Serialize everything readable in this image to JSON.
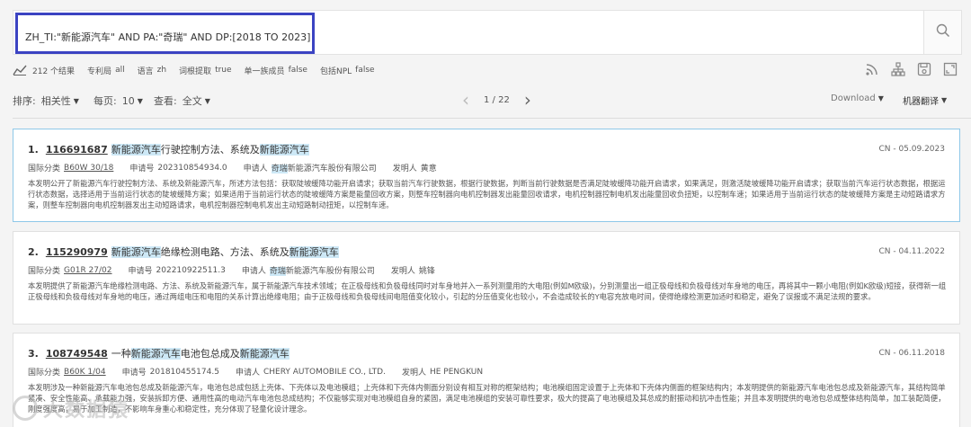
{
  "search": {
    "query": "ZH_TI:\"新能源汽车\" AND PA:\"奇瑞\" AND DP:[2018 TO 2023]"
  },
  "stats": {
    "results": "212 个结果",
    "patent_office_label": "专利局",
    "patent_office_value": "all",
    "language_label": "语言",
    "language_value": "zh",
    "stemming_label": "词根提取",
    "stemming_value": "true",
    "single_family_label": "单一族成员",
    "single_family_value": "false",
    "npl_label": "包括NPL",
    "npl_value": "false"
  },
  "toolbar": {
    "sort_label": "排序:",
    "sort_value": "相关性",
    "per_page_label": "每页:",
    "per_page_value": "10",
    "view_label": "查看:",
    "view_value": "全文",
    "page_indicator": "1 / 22",
    "download_label": "Download",
    "translate_label": "机器翻译"
  },
  "results": [
    {
      "index": "1.",
      "pub_no": "116691687",
      "title_hl1": "新能源汽车",
      "title_mid": "行驶控制方法、系统及",
      "title_hl2": "新能源汽车",
      "date": "CN - 05.09.2023",
      "ipc_label": "国际分类",
      "ipc": "B60W 30/18",
      "app_label": "申请号",
      "app_no": "202310854934.0",
      "applicant_label": "申请人",
      "applicant_hl": "奇瑞",
      "applicant_rest": "新能源汽车股份有限公司",
      "inventor_label": "发明人",
      "inventor": "黄意",
      "abstract": "本发明公开了新能源汽车行驶控制方法、系统及新能源汽车，所述方法包括：获取陡坡缓降功能开启请求；获取当前汽车行驶数据，根据行驶数据，判断当前行驶数据是否满足陡坡缓降功能开启请求，如果满足，则激活陡坡缓降功能开启请求；获取当前汽车运行状态数据，根据运行状态数据，选择适用于当前运行状态的陡坡缓降方案；如果适用于当前运行状态的陡坡缓降方案是能量回收方案，则整车控制器向电机控制器发出能量回收请求，电机控制器控制电机发出能量回收负扭矩，以控制车速；如果适用于当前运行状态的陡坡缓降方案是主动短路请求方案，则整车控制器向电机控制器发出主动短路请求，电机控制器控制电机发出主动短路制动扭矩，以控制车速。"
    },
    {
      "index": "2.",
      "pub_no": "115290979",
      "title_hl1": "新能源汽车",
      "title_mid": "绝缘检测电路、方法、系统及",
      "title_hl2": "新能源汽车",
      "date": "CN - 04.11.2022",
      "ipc_label": "国际分类",
      "ipc": "G01R 27/02",
      "app_label": "申请号",
      "app_no": "202210922511.3",
      "applicant_label": "申请人",
      "applicant_hl": "奇瑞",
      "applicant_rest": "新能源汽车股份有限公司",
      "inventor_label": "发明人",
      "inventor": "姚锋",
      "abstract": "本发明提供了新能源汽车绝缘检测电路、方法、系统及新能源汽车，属于新能源汽车技术领域；在正极母线和负极母线同时对车身地并入一系列测量用的大电阻(例如M欧级)，分别测量出一组正极母线和负极母线对车身地的电压，再将其中一颗小电阻(例如K欧级)短接，获得新一组正极母线和负极母线对车身地的电压，通过两组电压和电阻的关系计算出绝缘电阻；由于正极母线和负极母线间电阻值变化较小，引起的分压值变化也较小，不会造成较长的Y电容充放电时间，使得绝缘检测更加适时和稳定，避免了误报或不满足法规的要求。"
    },
    {
      "index": "3.",
      "pub_no": "108749548",
      "title_pre": "一种",
      "title_hl1": "新能源汽车",
      "title_mid": "电池包总成及",
      "title_hl2": "新能源汽车",
      "date": "CN - 06.11.2018",
      "ipc_label": "国际分类",
      "ipc": "B60K 1/04",
      "app_label": "申请号",
      "app_no": "201810455174.5",
      "applicant_label": "申请人",
      "applicant_rest": "CHERY AUTOMOBILE CO., LTD.",
      "inventor_label": "发明人",
      "inventor": "HE PENGKUN",
      "abstract": "本发明涉及一种新能源汽车电池包总成及新能源汽车，电池包总成包括上壳体、下壳体以及电池模组；上壳体和下壳体内侧面分别设有相互对称的框架结构；电池模组固定设置于上壳体和下壳体内侧面的框架结构内；本发明提供的新能源汽车电池包总成及新能源汽车，其结构简单紧凑、安全性能高、承载能力强，安装拆卸方便、通用性高的电动汽车电池包总成结构；不仅能够实现对电池模组自身的紧固，满足电池模组的安装可靠性要求，极大的提高了电池模组及其总成的耐振动和抗冲击性能；并且本发明提供的电池包总成整体结构简单，加工装配简便，刚度强度高，易于加工制造，不影响车身重心和稳定性，充分体现了轻量化设计理念。"
    }
  ],
  "watermark": "大数据猿",
  "icons": [
    "search-icon",
    "stats-icon",
    "rss-icon",
    "sitemap-icon",
    "save-icon",
    "expand-icon"
  ]
}
